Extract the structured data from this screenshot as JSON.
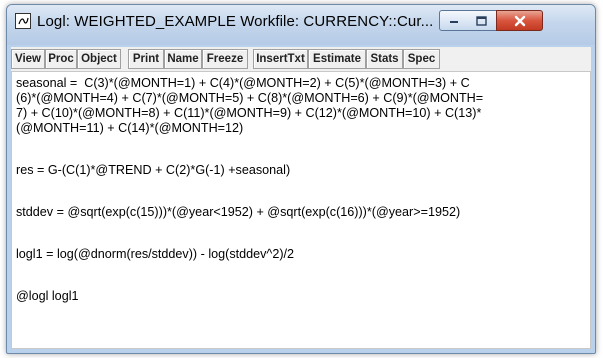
{
  "window": {
    "title": "Logl: WEIGHTED_EXAMPLE   Workfile: CURRENCY::Cur...",
    "icon": "equation-object-icon"
  },
  "title_buttons": {
    "minimize_icon": "minimize-icon",
    "maximize_icon": "maximize-icon",
    "close_icon": "close-icon",
    "close_color": "#c7402a"
  },
  "toolbar": {
    "buttons": [
      "View",
      "Proc",
      "Object",
      "Print",
      "Name",
      "Freeze",
      "InsertTxt",
      "Estimate",
      "Stats",
      "Spec"
    ]
  },
  "editor": {
    "lines": [
      "seasonal =  C(3)*(@MONTH=1) + C(4)*(@MONTH=2) + C(5)*(@MONTH=3) + C",
      "(6)*(@MONTH=4) + C(7)*(@MONTH=5) + C(8)*(@MONTH=6) + C(9)*(@MONTH=",
      "7) + C(10)*(@MONTH=8) + C(11)*(@MONTH=9) + C(12)*(@MONTH=10) + C(13)*",
      "(@MONTH=11) + C(14)*(@MONTH=12)",
      "res = G-(C(1)*@TREND + C(2)*G(-1) +seasonal)",
      "stddev = @sqrt(exp(c(15)))*(@year<1952) + @sqrt(exp(c(16)))*(@year>=1952)",
      "logl1 = log(@dnorm(res/stddev)) - log(stddev^2)/2",
      "@logl logl1"
    ]
  }
}
